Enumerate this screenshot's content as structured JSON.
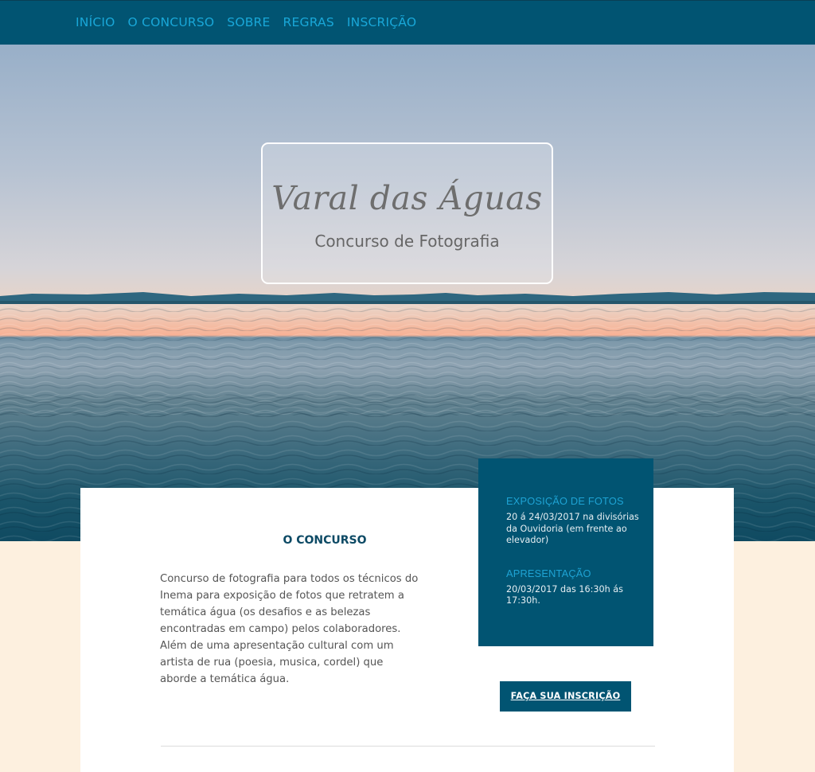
{
  "nav": {
    "items": [
      {
        "label": "INÍCIO"
      },
      {
        "label": "O CONCURSO"
      },
      {
        "label": "SOBRE"
      },
      {
        "label": "REGRAS"
      },
      {
        "label": "INSCRIÇÃO"
      }
    ]
  },
  "hero": {
    "title": "Varal das Águas",
    "subtitle": "Concurso de Fotografia"
  },
  "concurso": {
    "heading": "O CONCURSO",
    "description": "Concurso de fotografia para todos os técnicos do Inema para exposição de fotos que retratem a temática água (os desafios e as belezas encontradas em campo) pelos colaboradores. Além de uma apresentação cultural com um artista de rua (poesia, musica, cordel) que aborde a temática água."
  },
  "info": {
    "exposicao_heading": "EXPOSIÇÃO DE FOTOS",
    "exposicao_text": "20 á 24/03/2017 na divisórias da Ouvidoria (em frente ao elevador)",
    "apresentacao_heading": "APRESENTAÇÃO",
    "apresentacao_text": "20/03/2017 das 16:30h ás 17:30h."
  },
  "cta": {
    "label": "FAÇA SUA INSCRIÇÃO"
  },
  "colors": {
    "nav_background": "#015472",
    "nav_link": "#19a7d8",
    "page_background": "#fdf0df",
    "heading": "#0d4a65"
  }
}
